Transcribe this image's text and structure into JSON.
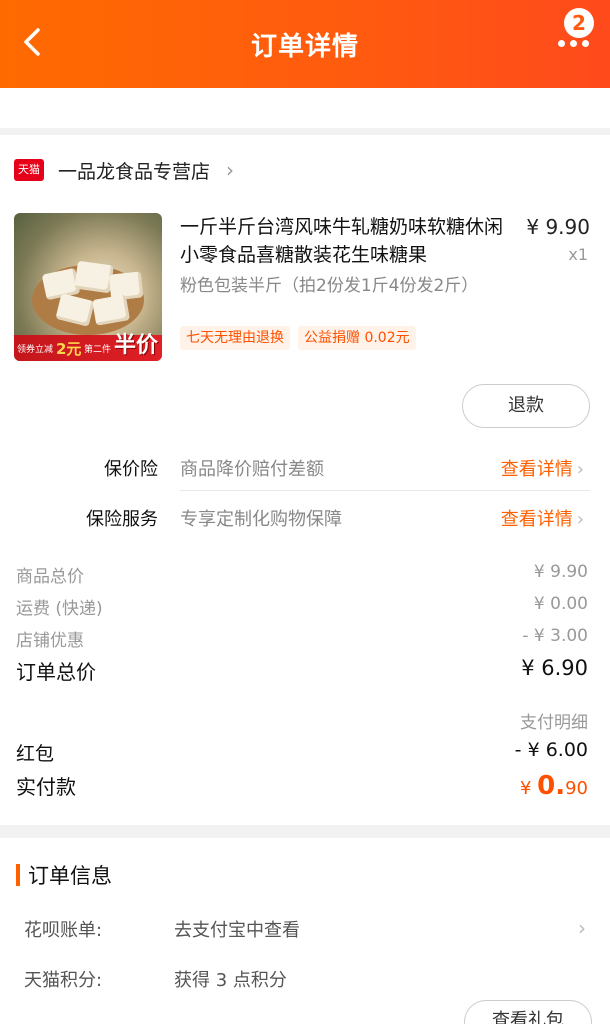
{
  "header": {
    "title": "订单详情",
    "badge_count": "2",
    "back_icon": "back-arrow-icon",
    "more_icon": "more-dots-icon"
  },
  "shop": {
    "logo_text": "天猫",
    "name": "一品龙食品专营店",
    "chevron": "›"
  },
  "product": {
    "title": "一斤半斤台湾风味牛轧糖奶味软糖休闲小零食品喜糖散装花生味糖果",
    "price": "¥ 9.90",
    "qty": "x1",
    "spec": "粉色包装半斤（拍2份发1斤4份发2斤）",
    "tags": [
      "七天无理由退换",
      "公益捐赠 0.02元"
    ],
    "image_text": {
      "coupon": "领券立减",
      "coupon_amount": "2元",
      "second": "第二件",
      "half": "半价"
    }
  },
  "refund_button": "退款",
  "insurance": [
    {
      "label": "保价险",
      "desc": "商品降价赔付差额",
      "link": "查看详情"
    },
    {
      "label": "保险服务",
      "desc": "专享定制化购物保障",
      "link": "查看详情"
    }
  ],
  "price_lines": [
    {
      "label": "商品总价",
      "value": "¥ 9.90"
    },
    {
      "label": "运费 (快递)",
      "value": "¥ 0.00"
    },
    {
      "label": "店铺优惠",
      "value": "- ¥ 3.00"
    }
  ],
  "order_total": {
    "label": "订单总价",
    "value": "¥ 6.90"
  },
  "pay_detail_label": "支付明细",
  "red_packet": {
    "label": "红包",
    "value": "- ¥ 6.00"
  },
  "paid": {
    "label": "实付款",
    "currency": "¥",
    "int": "0.",
    "dec": "90"
  },
  "order_info": {
    "title": "订单信息",
    "rows": [
      {
        "key": "花呗账单:",
        "value": "去支付宝中查看"
      },
      {
        "key": "天猫积分:",
        "value": "获得 3 点积分"
      }
    ]
  },
  "gift_button": "查看礼包",
  "colors": {
    "accent": "#ff5a10",
    "orange_text": "#ff6000"
  }
}
